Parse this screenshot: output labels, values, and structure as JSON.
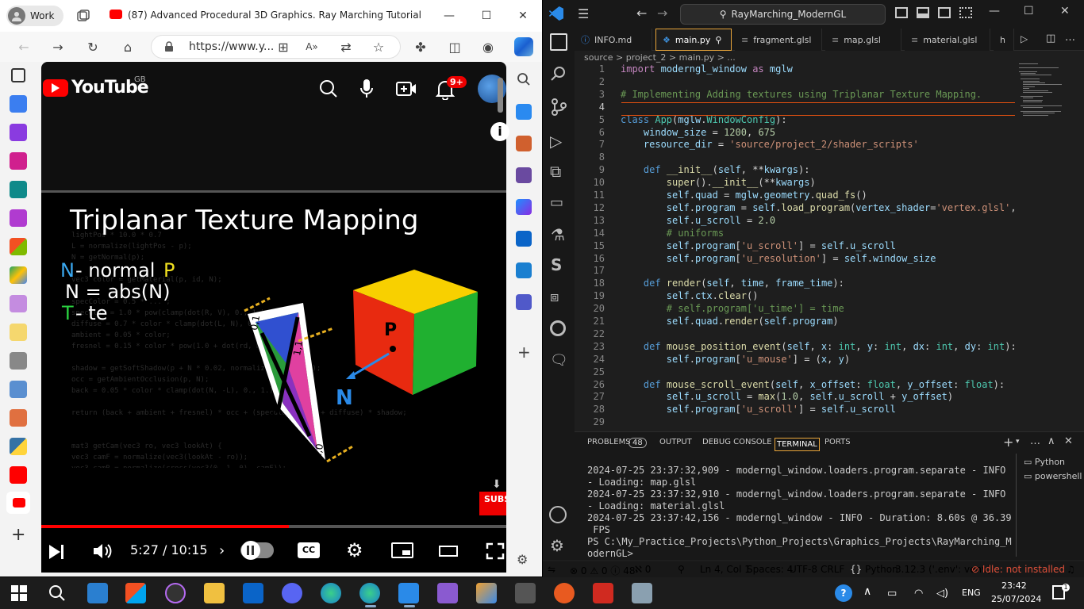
{
  "edge": {
    "profile": "Work",
    "tab_title": "(87) Advanced Procedural 3D Graphics. Ray Marching Tutorial - You...",
    "url": "https://www.y..."
  },
  "youtube": {
    "logo": "YouTube",
    "region": "GB",
    "notifications": "9+",
    "video_title": "Triplanar Texture Mapping",
    "overlay": {
      "n_label": "N",
      "n_text": " - normal ",
      "p_label": "P",
      "n_eq": "N = abs(N)",
      "t_label": "T",
      "t_text": " - te",
      "cube_p": "P",
      "arrow_n": "N",
      "uv": [
        "0,1",
        "1,1",
        "0,0",
        "1,0"
      ]
    },
    "subscribe": "SUBSCRIBE",
    "time": "5:27 / 10:15",
    "progress_fraction": 0.533,
    "cc": "CC"
  },
  "vscode": {
    "search": "RayMarching_ModernGL",
    "tabs": [
      {
        "label": "INFO.md",
        "icon": "info-icon"
      },
      {
        "label": "main.py",
        "icon": "python-icon",
        "active": true
      },
      {
        "label": "fragment.glsl",
        "icon": "glsl-icon"
      },
      {
        "label": "map.glsl",
        "icon": "glsl-icon"
      },
      {
        "label": "material.glsl",
        "icon": "glsl-icon"
      },
      {
        "label": "h",
        "icon": "glsl-icon"
      }
    ],
    "breadcrumb": "source  >  project_2  >  main.py  >  ...",
    "code_lines": [
      {
        "n": "1",
        "t": "import moderngl_window as mglw"
      },
      {
        "n": "2",
        "t": ""
      },
      {
        "n": "3",
        "t": "# Implementing Adding textures using Triplanar Texture Mapping."
      },
      {
        "n": "4",
        "t": ""
      },
      {
        "n": "5",
        "t": "class App(mglw.WindowConfig):"
      },
      {
        "n": "6",
        "t": "    window_size = 1200, 675"
      },
      {
        "n": "7",
        "t": "    resource_dir = 'source/project_2/shader_scripts'"
      },
      {
        "n": "8",
        "t": ""
      },
      {
        "n": "9",
        "t": "    def __init__(self, **kwargs):"
      },
      {
        "n": "10",
        "t": "        super().__init__(**kwargs)"
      },
      {
        "n": "11",
        "t": "        self.quad = mglw.geometry.quad_fs()"
      },
      {
        "n": "12",
        "t": "        self.program = self.load_program(vertex_shader='vertex.glsl',"
      },
      {
        "n": "13",
        "t": "        self.u_scroll = 2.0"
      },
      {
        "n": "14",
        "t": "        # uniforms"
      },
      {
        "n": "15",
        "t": "        self.program['u_scroll'] = self.u_scroll"
      },
      {
        "n": "16",
        "t": "        self.program['u_resolution'] = self.window_size"
      },
      {
        "n": "17",
        "t": ""
      },
      {
        "n": "18",
        "t": "    def render(self, time, frame_time):"
      },
      {
        "n": "19",
        "t": "        self.ctx.clear()"
      },
      {
        "n": "20",
        "t": "        # self.program['u_time'] = time"
      },
      {
        "n": "21",
        "t": "        self.quad.render(self.program)"
      },
      {
        "n": "22",
        "t": ""
      },
      {
        "n": "23",
        "t": "    def mouse_position_event(self, x: int, y: int, dx: int, dy: int):"
      },
      {
        "n": "24",
        "t": "        self.program['u_mouse'] = (x, y)"
      },
      {
        "n": "25",
        "t": ""
      },
      {
        "n": "26",
        "t": "    def mouse_scroll_event(self, x_offset: float, y_offset: float):"
      },
      {
        "n": "27",
        "t": "        self.u_scroll = max(1.0, self.u_scroll + y_offset)"
      },
      {
        "n": "28",
        "t": "        self.program['u_scroll'] = self.u_scroll"
      },
      {
        "n": "29",
        "t": ""
      }
    ],
    "panel_tabs": [
      "PROBLEMS",
      "OUTPUT",
      "DEBUG CONSOLE",
      "TERMINAL",
      "PORTS"
    ],
    "problems_count": "48",
    "terminal_lines": [
      "2024-07-25 23:37:32,909 - moderngl_window.loaders.program.separate - INFO",
      "- Loading: map.glsl",
      "2024-07-25 23:37:32,910 - moderngl_window.loaders.program.separate - INFO",
      "- Loading: material.glsl",
      "2024-07-25 23:37:42,156 - moderngl_window - INFO - Duration: 8.60s @ 36.39",
      " FPS",
      "PS C:\\My_Practice_Projects\\Python_Projects\\Graphics_Projects\\RayMarching_M",
      "odernGL> "
    ],
    "terminals": [
      "Python",
      "powershell"
    ],
    "status": {
      "errors": "0",
      "warnings": "0",
      "infos": "48",
      "ports": "0",
      "position": "Ln 4, Col 1",
      "spaces": "Spaces: 4",
      "encoding": "UTF-8",
      "eol": "CRLF",
      "language": "Python",
      "interpreter": "3.12.3 ('.env': venv)",
      "lint": "Idle: not installed"
    }
  },
  "taskbar": {
    "lang": "ENG",
    "time": "23:42",
    "date": "25/07/2024"
  }
}
